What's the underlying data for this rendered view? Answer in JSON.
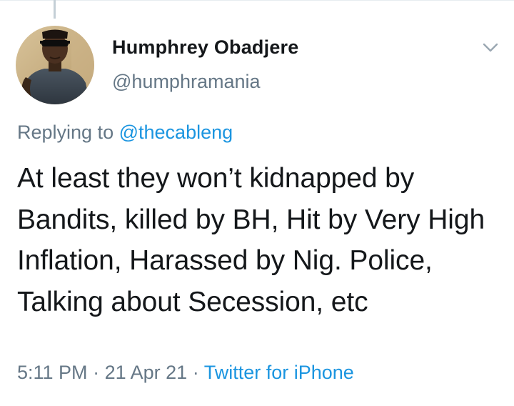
{
  "tweet": {
    "author": {
      "name": "Humphrey Obadjere",
      "handle": "@humphramania"
    },
    "replying_prefix": "Replying to",
    "replying_to": "@thecableng",
    "text": "At least they won’t kidnapped by Bandits, killed by BH, Hit by Very High Inflation, Harassed by Nig. Police, Talking about Secession, etc",
    "time": "5:11 PM",
    "separator": "·",
    "date": "21 Apr 21",
    "source": "Twitter for iPhone"
  },
  "icons": {
    "caret": "chevron-down-icon",
    "avatar": "profile-photo"
  },
  "colors": {
    "text": "#14171a",
    "secondary": "#657786",
    "link": "#1b95e0",
    "thread_line": "#c4cfd6"
  }
}
